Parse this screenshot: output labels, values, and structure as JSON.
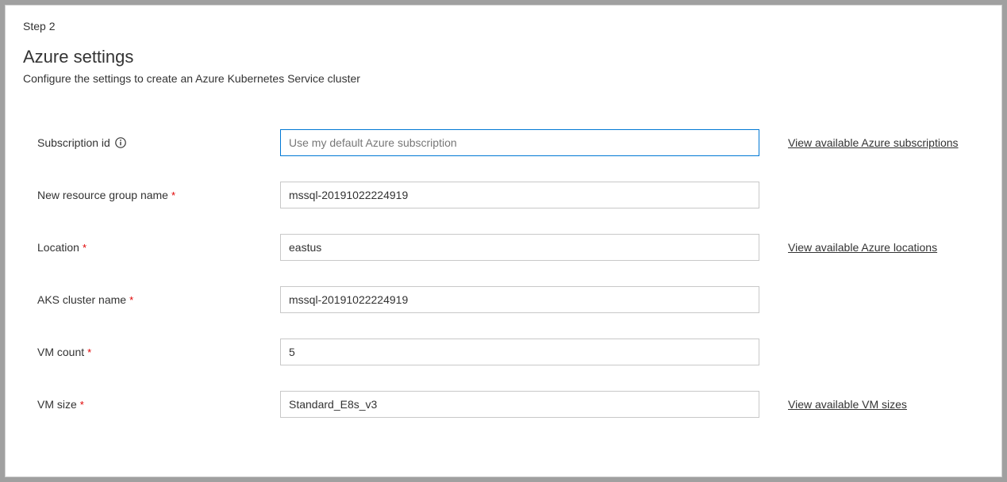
{
  "step_label": "Step 2",
  "title": "Azure settings",
  "subtitle": "Configure the settings to create an Azure Kubernetes Service cluster",
  "fields": {
    "subscription_id": {
      "label": "Subscription id",
      "required": false,
      "has_info": true,
      "value": "",
      "placeholder": "Use my default Azure subscription",
      "link": "View available Azure subscriptions",
      "focused": true
    },
    "resource_group": {
      "label": "New resource group name",
      "required": true,
      "has_info": false,
      "value": "mssql-20191022224919",
      "placeholder": "",
      "link": null
    },
    "location": {
      "label": "Location",
      "required": true,
      "has_info": false,
      "value": "eastus",
      "placeholder": "",
      "link": "View available Azure locations"
    },
    "aks_cluster_name": {
      "label": "AKS cluster name",
      "required": true,
      "has_info": false,
      "value": "mssql-20191022224919",
      "placeholder": "",
      "link": null
    },
    "vm_count": {
      "label": "VM count",
      "required": true,
      "has_info": false,
      "value": "5",
      "placeholder": "",
      "link": null
    },
    "vm_size": {
      "label": "VM size",
      "required": true,
      "has_info": false,
      "value": "Standard_E8s_v3",
      "placeholder": "",
      "link": "View available VM sizes"
    }
  }
}
